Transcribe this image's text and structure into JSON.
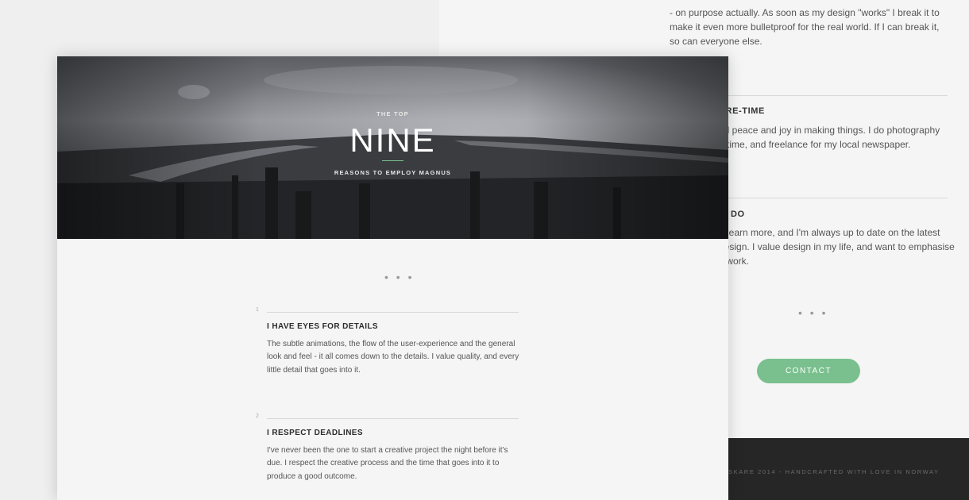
{
  "back_page": {
    "intro_text": "- on purpose actually. As soon as my design \"works\" I break it to make it even more bulletproof for the real world. If I can break it, so can everyone else.",
    "section_2": {
      "heading": "ARE-TIME",
      "body": "nd peace and joy in making things. I do photography\ne time, and freelance for my local newspaper."
    },
    "section_3": {
      "heading": "DO",
      "body": "o learn more, and I'm always up to date on the latest\ndesign. I value design in my life, and want to emphasise\ny work."
    },
    "dots": "• • •",
    "contact_label": "CONTACT",
    "footer_text": "SKARE 2014 - HANDCRAFTED WITH LOVE IN NORWAY"
  },
  "hero": {
    "kicker": "THE TOP",
    "title": "NINE",
    "subtitle": "REASONS TO EMPLOY MAGNUS"
  },
  "front_dots": "• • •",
  "reasons": [
    {
      "number": "1",
      "title": "I HAVE EYES FOR DETAILS",
      "body": "The subtle animations, the flow of the user-experience and the general look and feel - it all comes down to the details. I value quality, and every little detail that goes into it."
    },
    {
      "number": "2",
      "title": "I RESPECT DEADLINES",
      "body": "I've never been the one to start a creative project the night before it's due. I respect the creative process and the time that goes into it to produce a good outcome."
    }
  ],
  "colors": {
    "accent": "#7ac08e",
    "footer_bg": "#262626"
  }
}
